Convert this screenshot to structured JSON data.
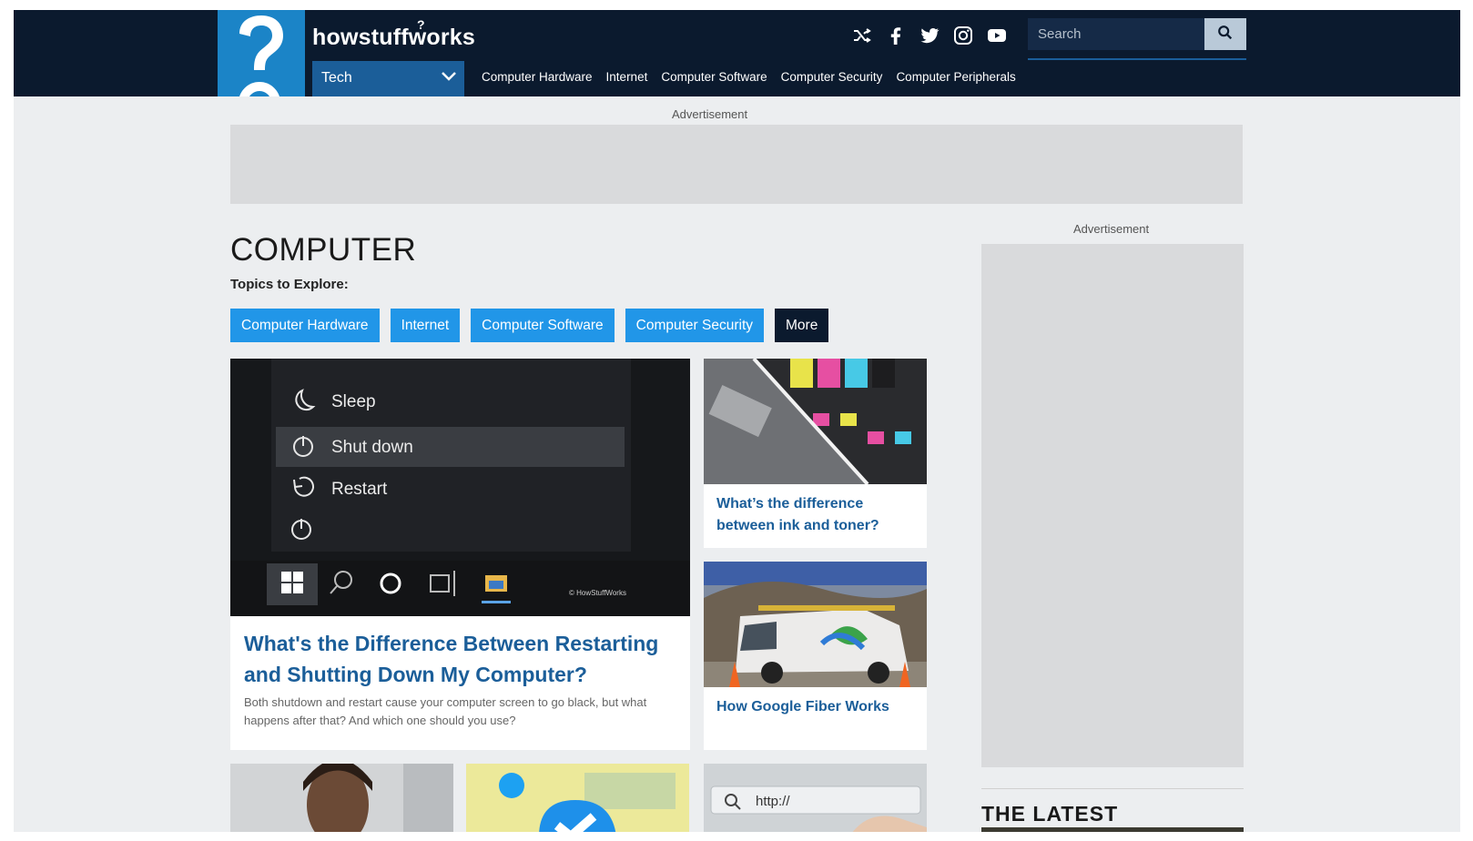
{
  "header": {
    "brand": "howstuffworks",
    "category_select": "Tech",
    "nav": [
      "Computer Hardware",
      "Internet",
      "Computer Software",
      "Computer Security",
      "Computer Peripherals"
    ],
    "social_icons": [
      "shuffle-icon",
      "facebook-icon",
      "twitter-icon",
      "instagram-icon",
      "youtube-icon"
    ],
    "search": {
      "placeholder": "Search"
    }
  },
  "ads": {
    "top_label": "Advertisement",
    "side_label": "Advertisement"
  },
  "category": {
    "title": "COMPUTER",
    "topics_label": "Topics to Explore:",
    "topics": [
      "Computer Hardware",
      "Internet",
      "Computer Software",
      "Computer Security"
    ],
    "more_label": "More"
  },
  "main_article": {
    "menu": [
      "Sleep",
      "Shut down",
      "Restart"
    ],
    "watermark": "© HowStuffWorks",
    "title": "What's the Difference Between Restarting and Shutting Down My Computer?",
    "description": "Both shutdown and restart cause your computer screen to go black, but what happens after that? And which one should you use?"
  },
  "side_articles": [
    {
      "title": "What’s the difference between ink and toner?"
    },
    {
      "title": "How Google Fiber Works"
    }
  ],
  "url_thumb_text": "http://",
  "latest_title": "THE LATEST",
  "colors": {
    "header": "#0b1a2e",
    "accent": "#2196e8",
    "link": "#1b5e99",
    "logo": "#1b84c7"
  }
}
